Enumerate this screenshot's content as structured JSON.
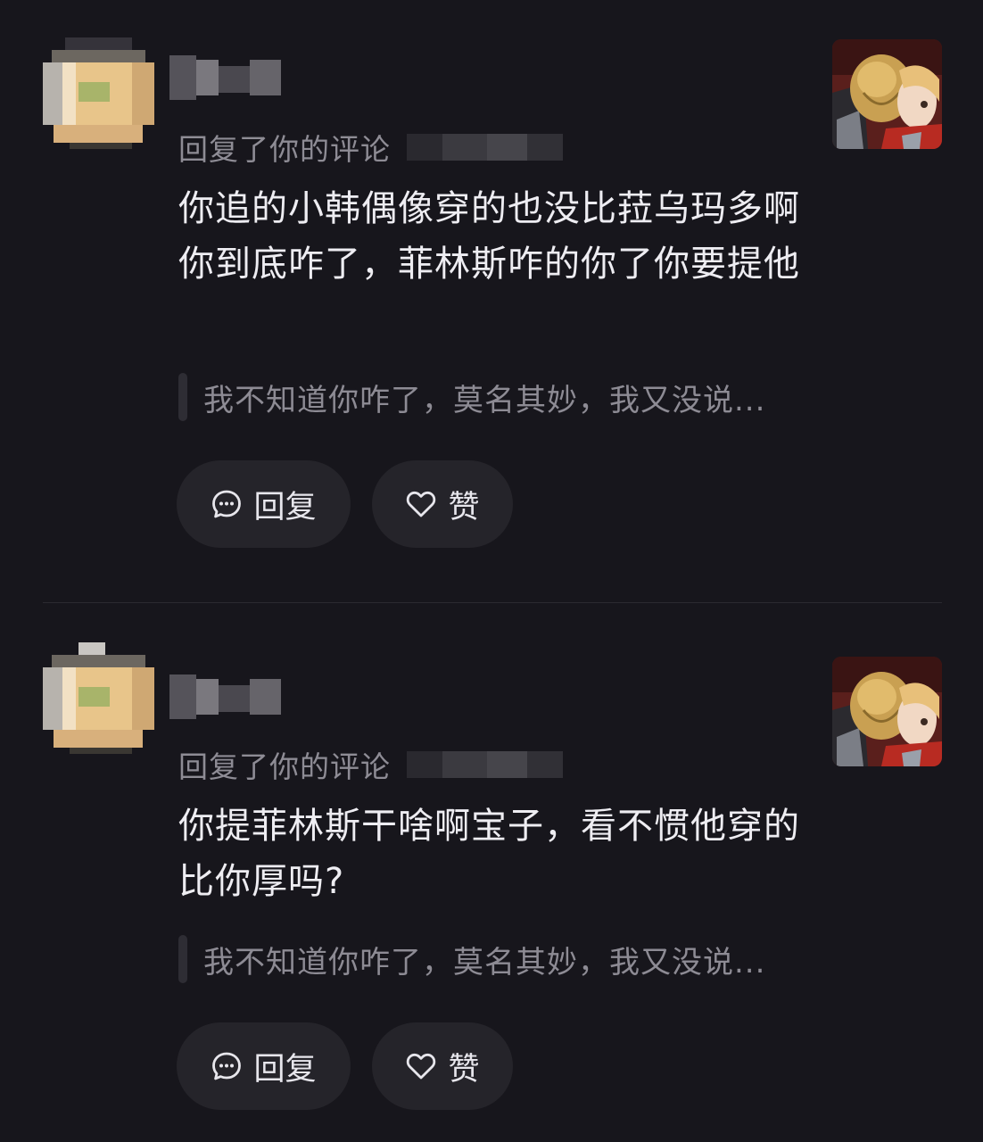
{
  "notifications": [
    {
      "action_text": "回复了你的评论",
      "comment_text": "你追的小韩偶像穿的也没比菈乌玛多啊你到底咋了，菲林斯咋的你了你要提他",
      "quoted_text": "我不知道你咋了，莫名其妙，我又没说...",
      "reply_label": "回复",
      "like_label": "赞"
    },
    {
      "action_text": "回复了你的评论",
      "comment_text": "你提菲林斯干啥啊宝子，看不惯他穿的比你厚吗?",
      "quoted_text": "我不知道你咋了，莫名其妙，我又没说...",
      "reply_label": "回复",
      "like_label": "赞"
    }
  ],
  "icons": {
    "reply": "chat-bubble-icon",
    "like": "heart-icon"
  },
  "colors": {
    "background": "#17161c",
    "button_bg": "#25242a",
    "secondary_text": "#8e8c95"
  }
}
